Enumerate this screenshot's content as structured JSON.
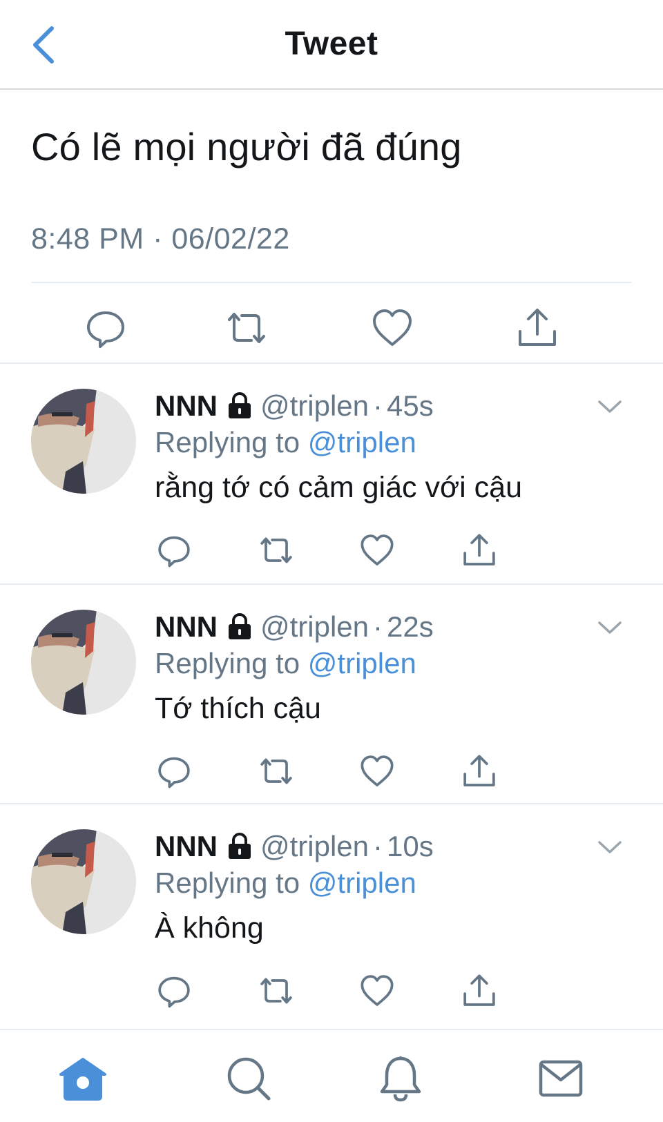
{
  "header": {
    "title": "Tweet",
    "back_icon": "chevron-left-icon"
  },
  "main_tweet": {
    "text": "Có lẽ mọi người đã đúng",
    "timestamp": "8:48 PM · 06/02/22",
    "actions": [
      "reply-icon",
      "retweet-icon",
      "like-icon",
      "share-icon"
    ]
  },
  "replies": [
    {
      "name": "NNN",
      "handle": "@triplen",
      "separator": "·",
      "time": "45s",
      "replying_prefix": "Replying to",
      "replying_to": "@triplen",
      "text": "rằng tớ có cảm giác với cậu"
    },
    {
      "name": "NNN",
      "handle": "@triplen",
      "separator": "·",
      "time": "22s",
      "replying_prefix": "Replying to",
      "replying_to": "@triplen",
      "text": "Tớ thích cậu"
    },
    {
      "name": "NNN",
      "handle": "@triplen",
      "separator": "·",
      "time": "10s",
      "replying_prefix": "Replying to",
      "replying_to": "@triplen",
      "text": "À không"
    }
  ],
  "tabbar": {
    "items": [
      "home-icon",
      "search-icon",
      "notifications-icon",
      "messages-icon"
    ],
    "active": "home-icon"
  },
  "colors": {
    "accent": "#4a90d9",
    "text": "#14171a",
    "secondary": "#657786",
    "divider": "#e6ecf0",
    "icon_gray": "#657786"
  }
}
